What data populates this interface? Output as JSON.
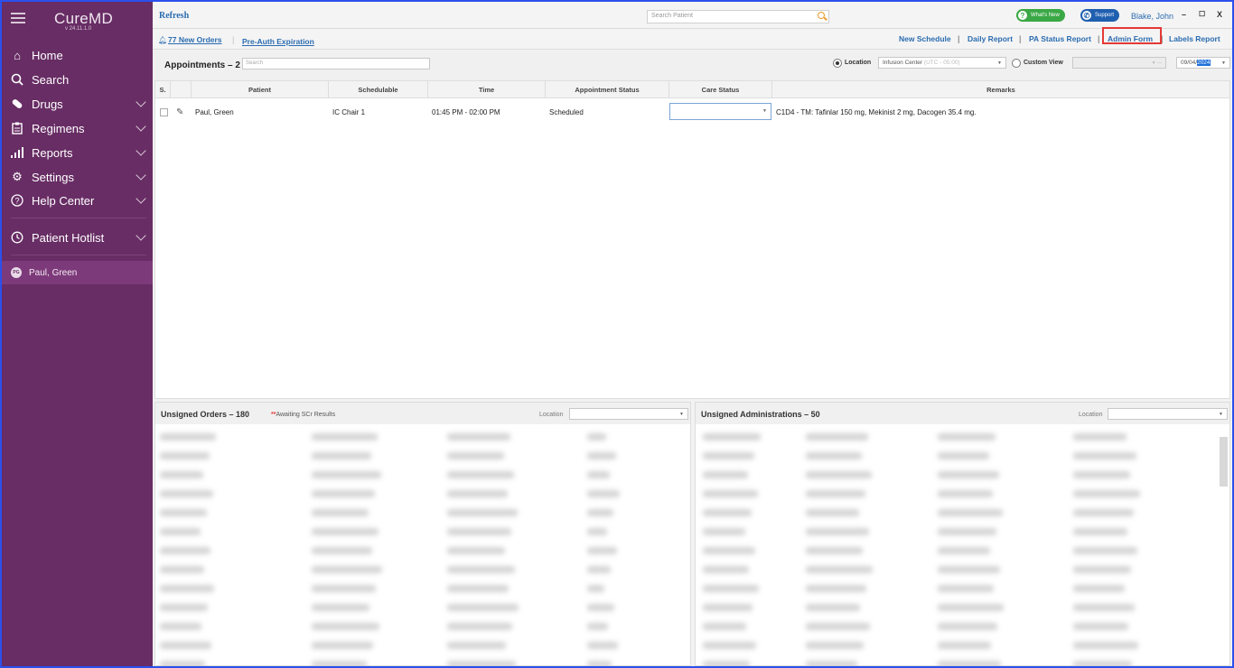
{
  "sidebar": {
    "logo": "CureMD",
    "version": "v 24.11.1.0",
    "items": [
      {
        "label": "Home",
        "icon": "home-icon",
        "chevron": false
      },
      {
        "label": "Search",
        "icon": "search-icon",
        "chevron": false
      },
      {
        "label": "Drugs",
        "icon": "pill-icon",
        "chevron": true
      },
      {
        "label": "Regimens",
        "icon": "clipboard-icon",
        "chevron": true
      },
      {
        "label": "Reports",
        "icon": "bar-chart-icon",
        "chevron": true
      },
      {
        "label": "Settings",
        "icon": "gear-icon",
        "chevron": true
      },
      {
        "label": "Help Center",
        "icon": "help-icon",
        "chevron": true
      },
      {
        "label": "Patient Hotlist",
        "icon": "history-icon",
        "chevron": true
      }
    ],
    "hotlist_patient": {
      "initials": "PG",
      "name": "Paul, Green"
    }
  },
  "topbar": {
    "refresh": "Refresh",
    "search_placeholder": "Search Patient",
    "whats_new": "What's New",
    "support": "Support",
    "user": "Blake, John",
    "minimize": "–",
    "maximize": "☐",
    "close": "X"
  },
  "links": {
    "new_orders": "77 New Orders",
    "preauth": "Pre-Auth Expiration",
    "new_schedule": "New Schedule",
    "daily_report": "Daily Report",
    "pa_status": "PA Status Report",
    "admin_form": "Admin Form",
    "labels_report": "Labels Report",
    "separator": "|"
  },
  "appointments": {
    "title": "Appointments – 2",
    "search_placeholder": "Search",
    "location_label": "Location",
    "location_value": "Infusion Center",
    "location_tz": "(UTC - 05:00)",
    "custom_view_label": "Custom View",
    "date_prefix": "09/04/",
    "date_year": "2024",
    "columns": [
      "S.",
      "",
      "Patient",
      "Schedulable",
      "Time",
      "Appointment Status",
      "Care Status",
      "Remarks"
    ],
    "rows": [
      {
        "patient": "Paul, Green",
        "schedulable": "IC Chair 1",
        "time": "01:45 PM - 02:00 PM",
        "status": "Scheduled",
        "care_status": "",
        "remarks": "C1D4 - TM: Tafinlar 150 mg, Mekinist 2 mg, Dacogen 35.4 mg."
      }
    ]
  },
  "unsigned_orders": {
    "title": "Unsigned Orders – 180",
    "note_marker": "**",
    "note": "Awaiting SCr Results",
    "location_label": "Location"
  },
  "unsigned_admins": {
    "title": "Unsigned Administrations – 50",
    "location_label": "Location"
  }
}
